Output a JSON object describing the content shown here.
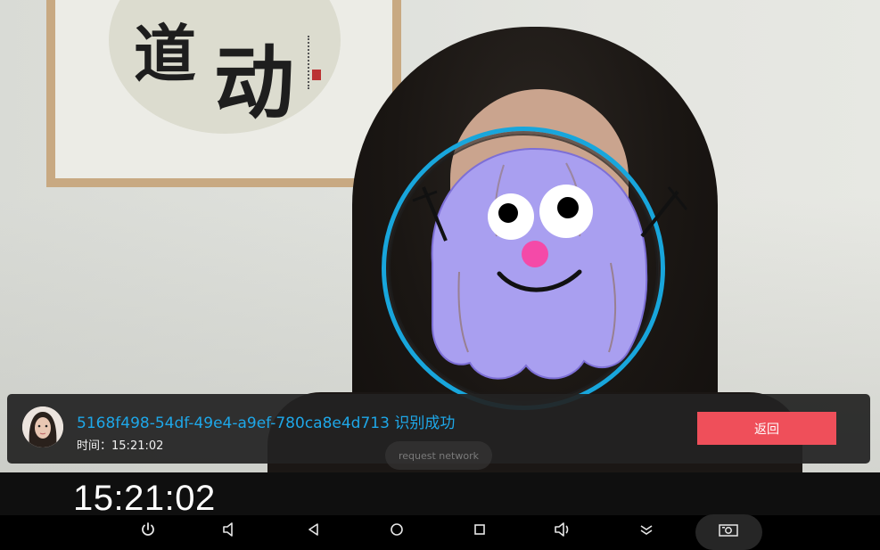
{
  "result": {
    "user_id": "5168f498-54df-49e4-a9ef-780ca8e4d713",
    "status": "识别成功",
    "time_label": "时间：",
    "time_value": "15:21:02"
  },
  "back_button": {
    "label": "返回"
  },
  "toast": {
    "text": "request network"
  },
  "clock": {
    "time": "15:21:02"
  },
  "calligraphy": [
    "道",
    "动"
  ],
  "navbar": {
    "buttons": [
      "power-icon",
      "volume-down-icon",
      "back-icon",
      "home-icon",
      "recents-icon",
      "volume-up-icon",
      "collapse-icon",
      "screenshot-icon"
    ]
  },
  "colors": {
    "accent_blue": "#1ea7e8",
    "ring_blue": "#18a6dc",
    "back_button_red": "#ef4f5a",
    "card_bg": "#222222",
    "mascot_purple": "#a99ff0"
  }
}
